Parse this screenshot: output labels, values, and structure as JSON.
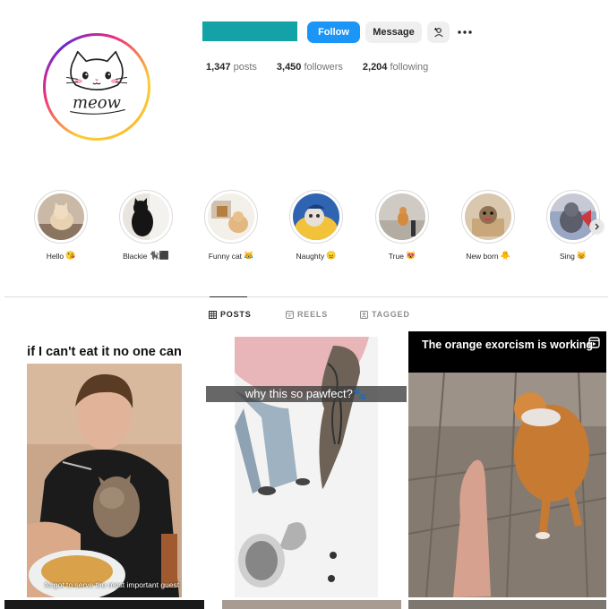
{
  "profile": {
    "follow_label": "Follow",
    "message_label": "Message",
    "stats": [
      {
        "value": "1,347",
        "label": "posts"
      },
      {
        "value": "3,450",
        "label": "followers"
      },
      {
        "value": "2,204",
        "label": "following"
      }
    ],
    "avatar_text": "meow",
    "colors": {
      "username_bar": "#13a3a6",
      "follow": "#1b95f6"
    }
  },
  "highlights": [
    {
      "label": "Hello",
      "emoji": "😘"
    },
    {
      "label": "Blackie",
      "emoji": "🐈‍⬛⬛"
    },
    {
      "label": "Funny cat",
      "emoji": "😹"
    },
    {
      "label": "Naughty",
      "emoji": "😠"
    },
    {
      "label": "True",
      "emoji": "😻"
    },
    {
      "label": "New born",
      "emoji": "🐥"
    },
    {
      "label": "Sing",
      "emoji": "😸"
    }
  ],
  "tabs": [
    {
      "label": "POSTS",
      "icon": "grid-icon"
    },
    {
      "label": "REELS",
      "icon": "reels-icon"
    },
    {
      "label": "TAGGED",
      "icon": "tagged-icon"
    }
  ],
  "posts": [
    {
      "caption": "if I can't eat it no one can",
      "subtitle": "forgot to serve the most important guest"
    },
    {
      "caption": "why this so pawfect?🐾"
    },
    {
      "caption": "The orange exorcism is working"
    }
  ]
}
